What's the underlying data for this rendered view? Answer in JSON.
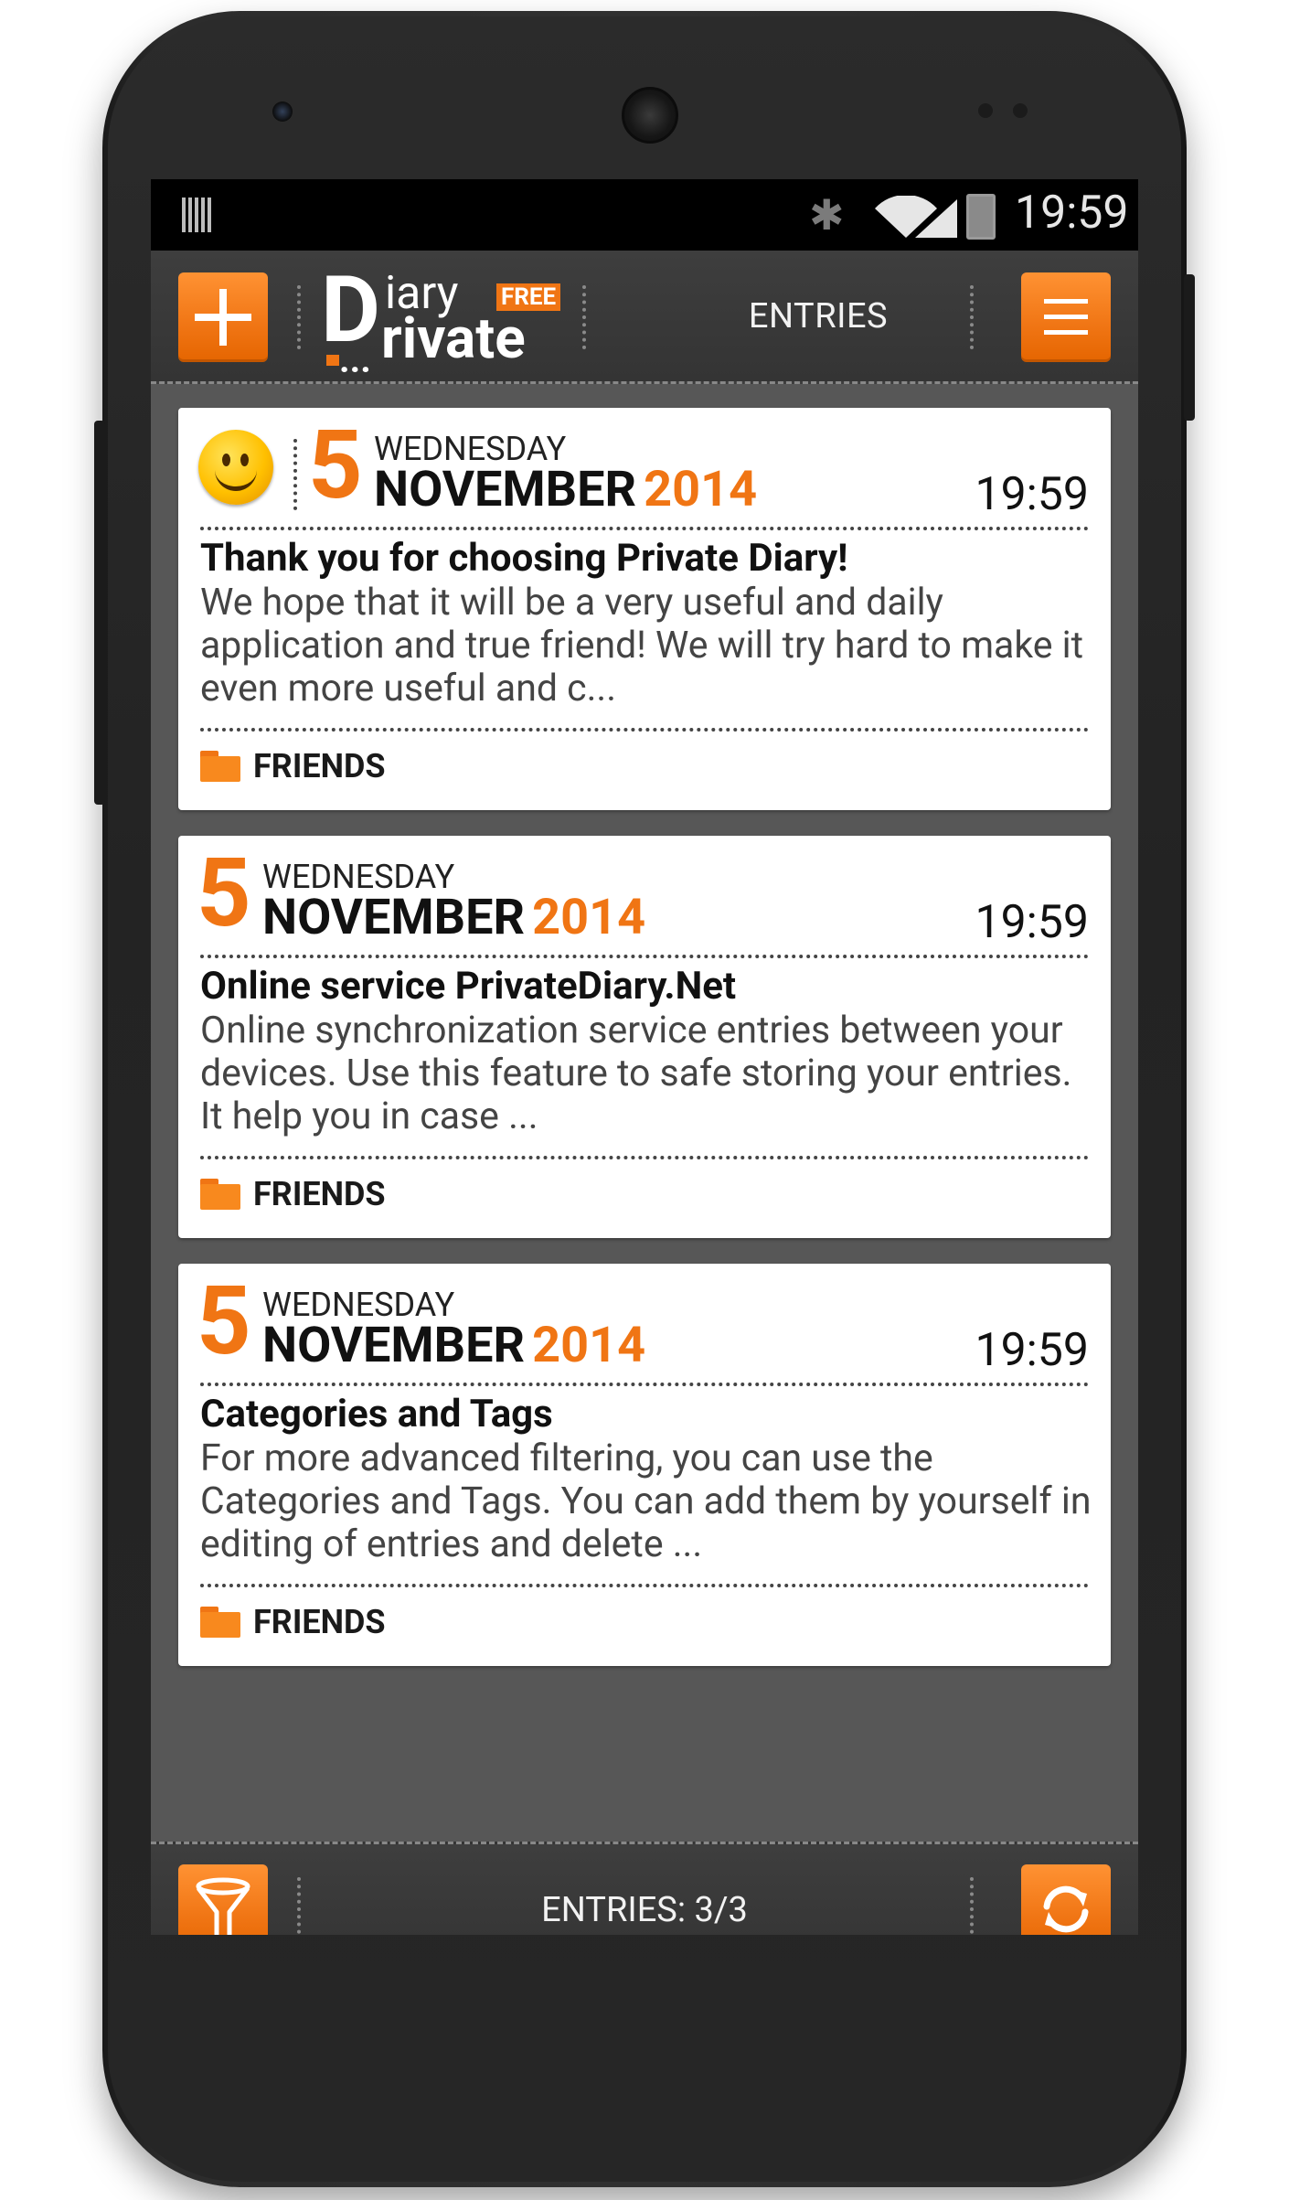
{
  "status_bar": {
    "time": "19:59"
  },
  "action_bar": {
    "logo_iary": "iary",
    "logo_free": "FREE",
    "logo_d": "D",
    "logo_rivate": "rivate",
    "logo_dots": "...",
    "title": "ENTRIES"
  },
  "entries": [
    {
      "day": "5",
      "weekday": "WEDNESDAY",
      "month": "NOVEMBER",
      "year": "2014",
      "time": "19:59",
      "title": "Thank you for choosing Private Diary!",
      "body": "We hope that it will be a very useful and daily application and true friend!  We will try hard to make it even more useful and c...",
      "category": "FRIENDS"
    },
    {
      "day": "5",
      "weekday": "WEDNESDAY",
      "month": "NOVEMBER",
      "year": "2014",
      "time": "19:59",
      "title": "Online service PrivateDiary.Net",
      "body": "Online synchronization service entries between your devices. Use this feature to safe storing your entries. It help you in case ...",
      "category": "FRIENDS"
    },
    {
      "day": "5",
      "weekday": "WEDNESDAY",
      "month": "NOVEMBER",
      "year": "2014",
      "time": "19:59",
      "title": "Categories and Tags",
      "body": "For more advanced filtering, you can use the Categories and Tags. You can add them by yourself in editing of entries and delete ...",
      "category": "FRIENDS"
    }
  ],
  "bottom_bar": {
    "entries_count": "ENTRIES: 3/3"
  },
  "icons": {
    "add": "plus-icon",
    "menu": "hamburger-menu-icon",
    "filter": "funnel-filter-icon",
    "sync": "sync-icon",
    "mood": "smiley-icon",
    "category": "folder-icon",
    "back": "back-icon",
    "home": "home-icon",
    "recents": "recents-icon"
  },
  "colors": {
    "accent": "#f07514",
    "bar": "#3a3a3a",
    "background": "#575757"
  }
}
